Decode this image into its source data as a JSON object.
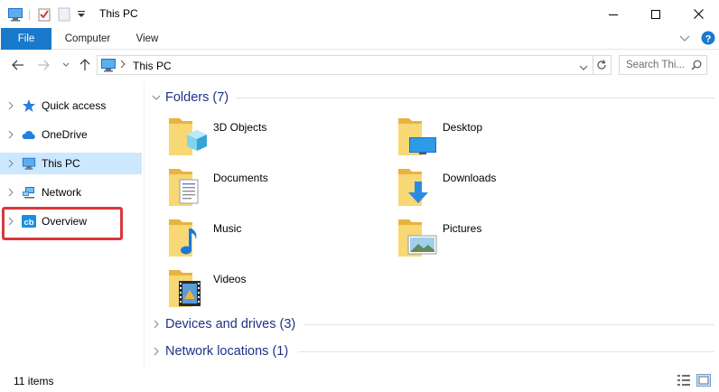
{
  "window": {
    "title": "This PC",
    "minimize_icon": "minimize-icon",
    "maximize_icon": "maximize-icon",
    "close_icon": "close-icon"
  },
  "ribbon": {
    "tabs": [
      {
        "label": "File"
      },
      {
        "label": "Computer"
      },
      {
        "label": "View"
      }
    ]
  },
  "address": {
    "path": "This PC",
    "search_placeholder": "Search Thi..."
  },
  "nav": {
    "items": [
      {
        "label": "Quick access"
      },
      {
        "label": "OneDrive"
      },
      {
        "label": "This PC"
      },
      {
        "label": "Network"
      },
      {
        "label": "Overview"
      }
    ]
  },
  "main": {
    "groups": [
      {
        "title": "Folders (7)"
      },
      {
        "title": "Devices and drives (3)"
      },
      {
        "title": "Network locations (1)"
      }
    ],
    "folders": [
      {
        "label": "3D Objects",
        "icon": "3d-objects-folder-icon"
      },
      {
        "label": "Desktop",
        "icon": "desktop-folder-icon"
      },
      {
        "label": "Documents",
        "icon": "documents-folder-icon"
      },
      {
        "label": "Downloads",
        "icon": "downloads-folder-icon"
      },
      {
        "label": "Music",
        "icon": "music-folder-icon"
      },
      {
        "label": "Pictures",
        "icon": "pictures-folder-icon"
      },
      {
        "label": "Videos",
        "icon": "videos-folder-icon"
      }
    ]
  },
  "status": {
    "item_count": "11 items"
  },
  "colors": {
    "accent": "#1979ca",
    "selected_bg": "#cce8ff",
    "group_title": "#1e3287",
    "highlight": "#d9383a",
    "folder_yellow": "#f8d775"
  }
}
